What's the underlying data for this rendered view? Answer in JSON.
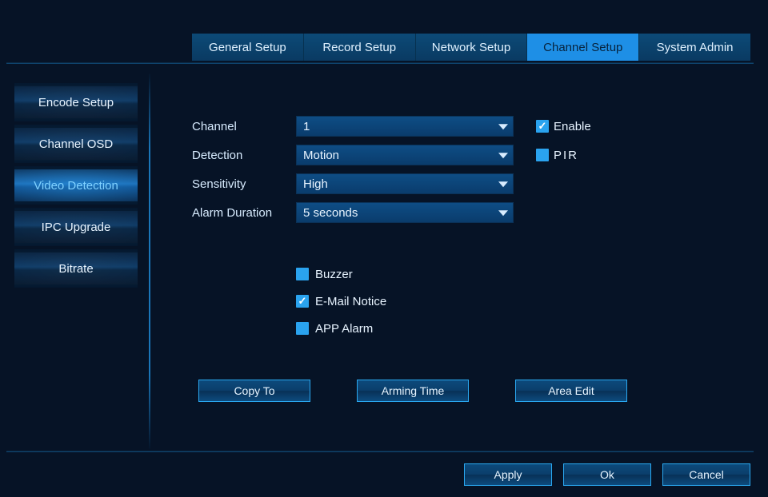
{
  "tabs": {
    "items": [
      {
        "label": "General Setup"
      },
      {
        "label": "Record Setup"
      },
      {
        "label": "Network Setup"
      },
      {
        "label": "Channel Setup",
        "active": true
      },
      {
        "label": "System Admin"
      }
    ]
  },
  "sidebar": {
    "items": [
      {
        "label": "Encode Setup"
      },
      {
        "label": "Channel OSD"
      },
      {
        "label": "Video Detection",
        "active": true
      },
      {
        "label": "IPC Upgrade"
      },
      {
        "label": "Bitrate"
      }
    ]
  },
  "form": {
    "channel_label": "Channel",
    "channel_value": "1",
    "detection_label": "Detection",
    "detection_value": "Motion",
    "sensitivity_label": "Sensitivity",
    "sensitivity_value": "High",
    "alarm_duration_label": "Alarm Duration",
    "alarm_duration_value": "5 seconds",
    "enable_label": "Enable",
    "enable_checked": true,
    "pir_label": "PIR",
    "pir_checked": false
  },
  "alerts": {
    "buzzer_label": "Buzzer",
    "buzzer_checked": false,
    "email_label": "E-Mail Notice",
    "email_checked": true,
    "app_label": "APP Alarm",
    "app_checked": false
  },
  "buttons": {
    "copy_to": "Copy To",
    "arming_time": "Arming Time",
    "area_edit": "Area Edit",
    "apply": "Apply",
    "ok": "Ok",
    "cancel": "Cancel"
  }
}
